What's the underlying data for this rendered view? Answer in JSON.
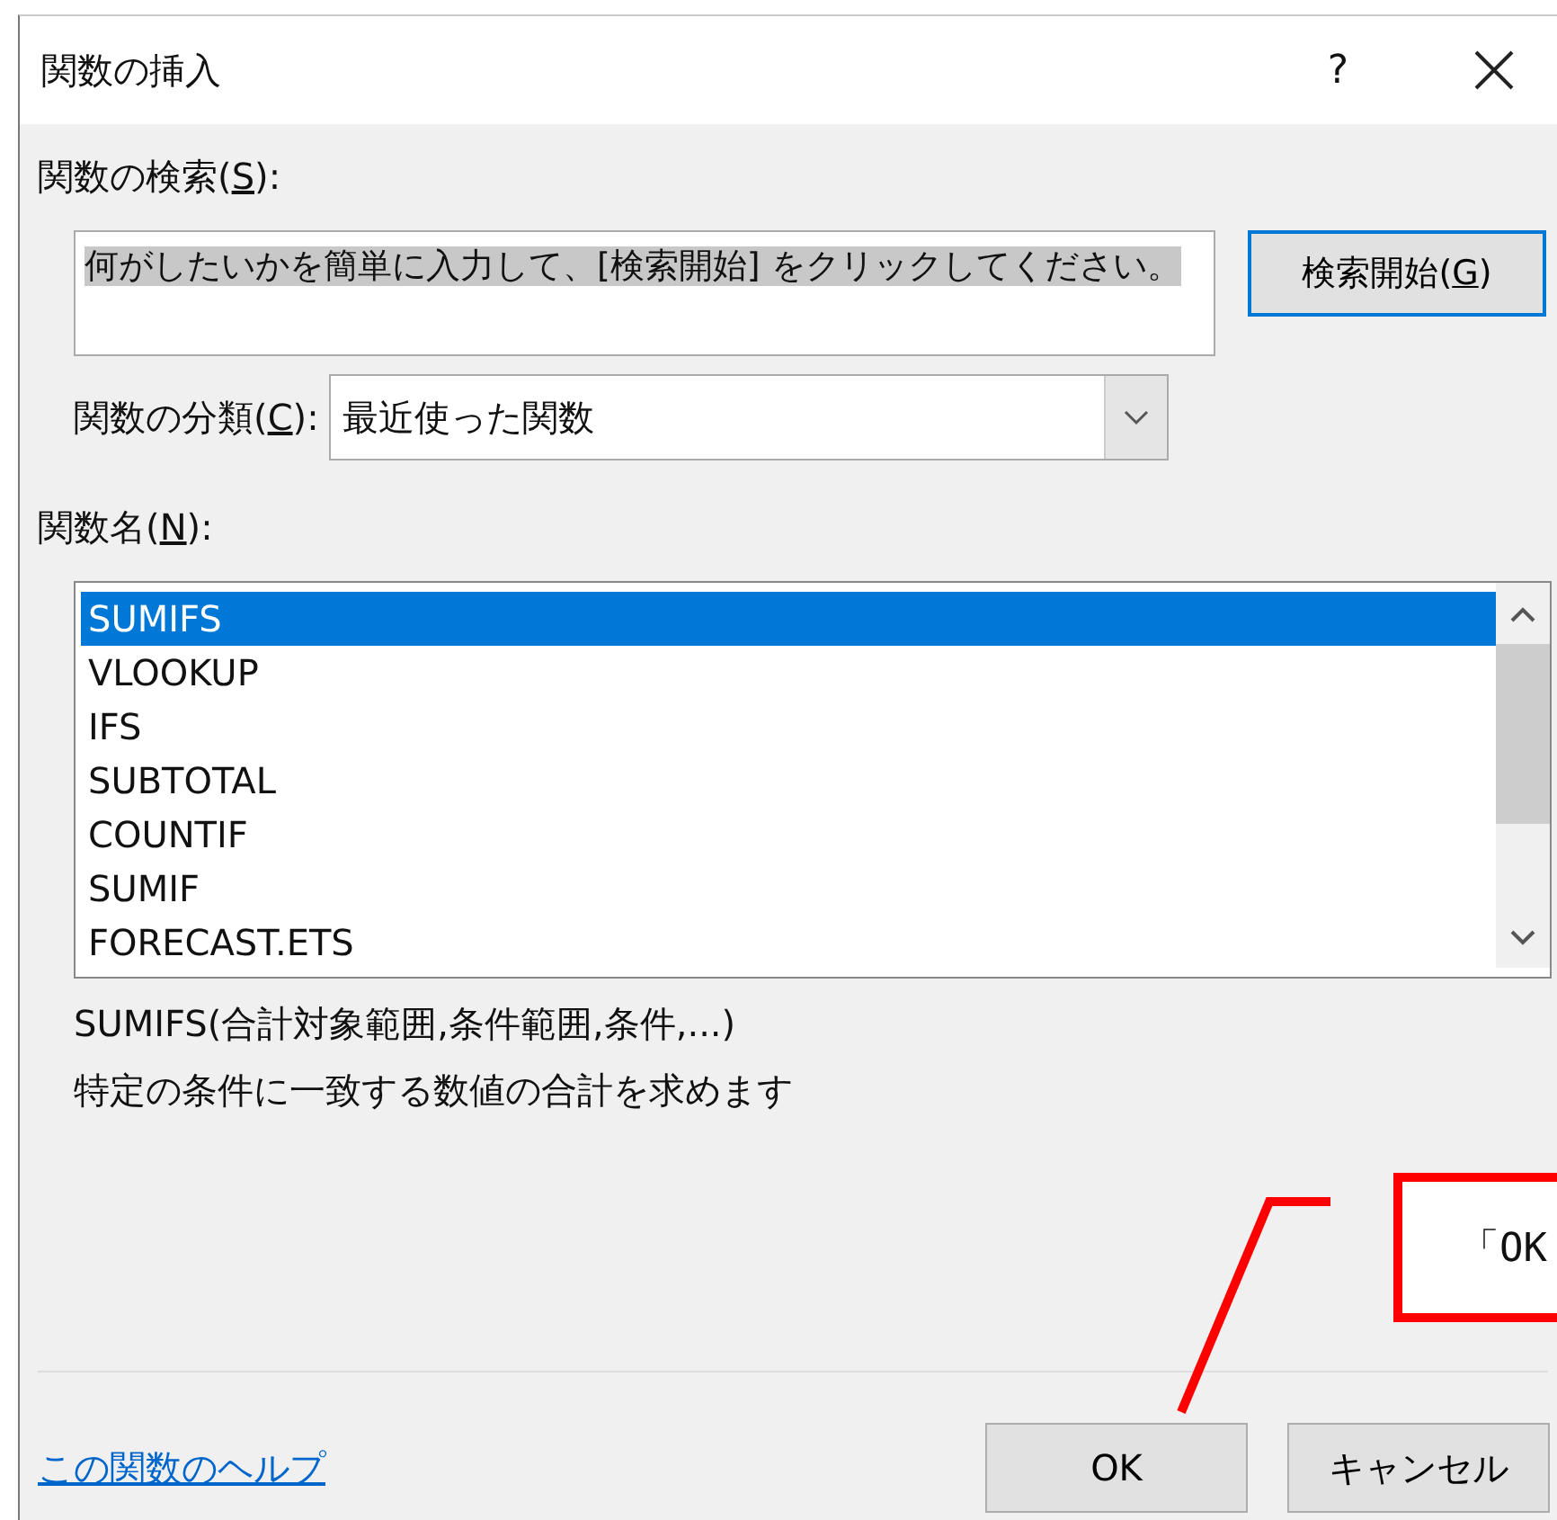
{
  "window": {
    "title": "関数の挿入",
    "help": "?"
  },
  "search": {
    "label": {
      "before": "関数の検索(",
      "key": "S",
      "after": "):"
    },
    "value": "何がしたいかを簡単に入力して、[検索開始] をクリックしてください。",
    "text_selected": true
  },
  "search_button": {
    "label": {
      "before": "検索開始(",
      "key": "G",
      "after": ")"
    },
    "default": true
  },
  "category": {
    "label": {
      "before": "関数の分類(",
      "key": "C",
      "after": "):"
    },
    "value": "最近使った関数"
  },
  "function_list": {
    "label": {
      "before": "関数名(",
      "key": "N",
      "after": "):"
    },
    "items": [
      {
        "name": "SUMIFS",
        "selected": true
      },
      {
        "name": "VLOOKUP",
        "selected": false
      },
      {
        "name": "IFS",
        "selected": false
      },
      {
        "name": "SUBTOTAL",
        "selected": false
      },
      {
        "name": "COUNTIF",
        "selected": false
      },
      {
        "name": "SUMIF",
        "selected": false
      },
      {
        "name": "FORECAST.ETS",
        "selected": false
      }
    ]
  },
  "signature": "SUMIFS(合計対象範囲,条件範囲,条件,...)",
  "description": "特定の条件に一致する数値の合計を求めます",
  "help_link": "この関数のヘルプ",
  "buttons": [
    {
      "label": "OK",
      "default": false
    },
    {
      "label": "キャンセル",
      "default": false
    }
  ],
  "callout": {
    "text": "「OK"
  }
}
